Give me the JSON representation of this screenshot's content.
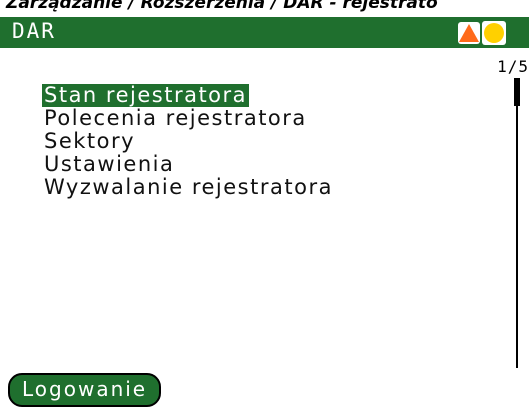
{
  "breadcrumb": "Zarządzanie / Rozszerzenia / DAR - rejestrato",
  "window": {
    "title": "DAR"
  },
  "icons": {
    "warning": "warning-triangle-icon",
    "status": "status-circle-icon"
  },
  "colors": {
    "titlebar": "#1f6f2e",
    "selection": "#1f6f2e",
    "warning": "#ff6a1a",
    "status": "#ffd000"
  },
  "page_indicator": "1/5",
  "menu": {
    "items": [
      {
        "label": "Stan rejestratora",
        "selected": true
      },
      {
        "label": "Polecenia rejestratora",
        "selected": false
      },
      {
        "label": "Sektory",
        "selected": false
      },
      {
        "label": "Ustawienia",
        "selected": false
      },
      {
        "label": "Wyzwalanie rejestratora",
        "selected": false
      }
    ]
  },
  "footer": {
    "login_label": "Logowanie"
  }
}
